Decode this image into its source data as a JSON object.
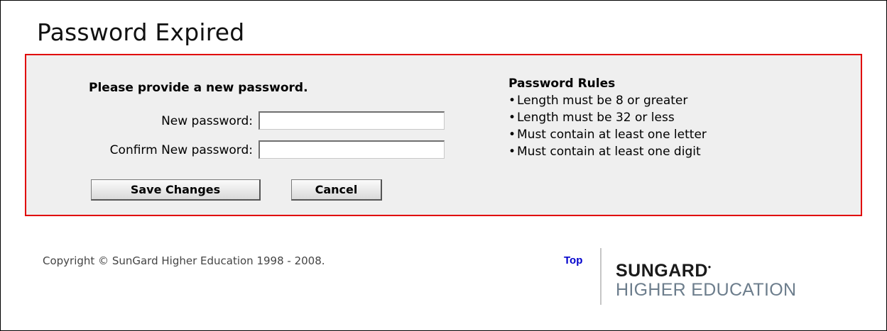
{
  "page": {
    "title": "Password Expired"
  },
  "form": {
    "heading": "Please provide a new password.",
    "new_password_label": "New password:",
    "new_password_value": "",
    "confirm_password_label": "Confirm New password:",
    "confirm_password_value": "",
    "save_label": "Save Changes",
    "cancel_label": "Cancel"
  },
  "rules": {
    "heading": "Password Rules",
    "items": [
      "Length must be 8 or greater",
      "Length must be 32 or less",
      "Must contain at least one letter",
      "Must contain at least one digit"
    ]
  },
  "footer": {
    "copyright": "Copyright © SunGard Higher Education 1998 - 2008.",
    "top_link": "Top",
    "logo_line1": "SUNGARD",
    "logo_line2": "HIGHER EDUCATION"
  },
  "colors": {
    "panel_border": "#e00000",
    "panel_background": "#efefef",
    "link": "#0000cc",
    "logo_secondary": "#6c7d8c"
  }
}
